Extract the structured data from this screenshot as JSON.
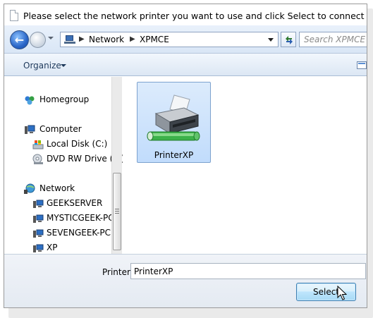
{
  "window": {
    "title": "Please select the network printer you want to use and click Select to connect to it"
  },
  "address_bar": {
    "crumbs": [
      "Network",
      "XPMCE"
    ]
  },
  "search": {
    "placeholder": "Search XPMCE"
  },
  "command_bar": {
    "organize_label": "Organize"
  },
  "nav_pane": {
    "items": [
      {
        "label": "Homegroup",
        "icon": "homegroup-icon"
      },
      {
        "label": "Computer",
        "icon": "computer-icon"
      },
      {
        "label": "Local Disk (C:)",
        "icon": "drive-icon"
      },
      {
        "label": "DVD RW Drive (E:)",
        "icon": "dvd-icon"
      },
      {
        "label": "Network",
        "icon": "network-icon"
      },
      {
        "label": "GEEKSERVER",
        "icon": "network-computer-icon"
      },
      {
        "label": "MYSTICGEEK-PC",
        "icon": "network-computer-icon"
      },
      {
        "label": "SEVENGEEK-PC",
        "icon": "network-computer-icon"
      },
      {
        "label": "XP",
        "icon": "network-computer-icon"
      }
    ]
  },
  "content": {
    "items": [
      {
        "label": "PrinterXP",
        "icon": "network-printer-icon",
        "selected": true
      }
    ]
  },
  "footer": {
    "printer_label": "Printer",
    "printer_value": "PrinterXP",
    "select_label": "Select"
  },
  "colors": {
    "selection": "#c1dcfc",
    "toolbar": "#dce7f4",
    "accent": "#3c7fb1"
  }
}
